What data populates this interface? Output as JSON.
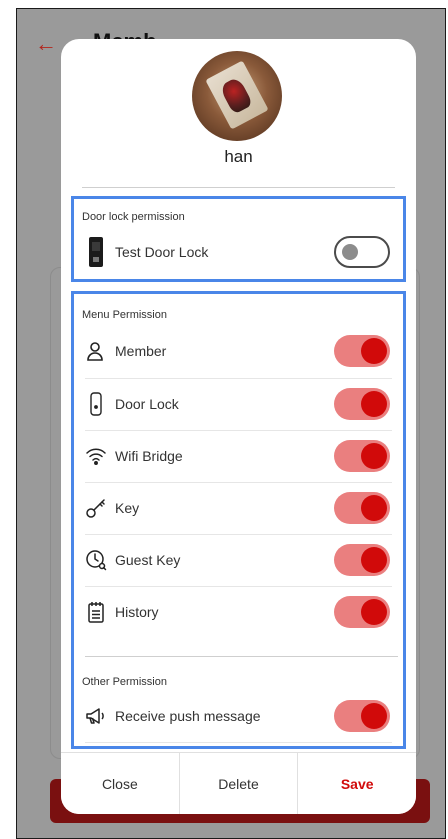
{
  "background": {
    "back_icon": "←",
    "title": "Memb"
  },
  "modal": {
    "user_name": "han",
    "door_lock_section": {
      "title": "Door lock permission",
      "device": {
        "label": "Test Door Lock",
        "enabled": false
      }
    },
    "menu_section": {
      "title": "Menu Permission",
      "items": [
        {
          "label": "Member",
          "icon": "person-icon",
          "enabled": true
        },
        {
          "label": "Door Lock",
          "icon": "door-lock-icon",
          "enabled": true
        },
        {
          "label": "Wifi Bridge",
          "icon": "wifi-icon",
          "enabled": true
        },
        {
          "label": "Key",
          "icon": "key-icon",
          "enabled": true
        },
        {
          "label": "Guest Key",
          "icon": "guest-key-icon",
          "enabled": true
        },
        {
          "label": "History",
          "icon": "history-icon",
          "enabled": true
        }
      ]
    },
    "other_section": {
      "title": "Other Permission",
      "items": [
        {
          "label": "Receive push message",
          "icon": "megaphone-icon",
          "enabled": true
        }
      ]
    },
    "footer": {
      "close_label": "Close",
      "delete_label": "Delete",
      "save_label": "Save"
    }
  },
  "colors": {
    "accent": "#d10a0a",
    "toggle_track_on": "#ea7f7f",
    "highlight_border": "#4a86e8"
  }
}
